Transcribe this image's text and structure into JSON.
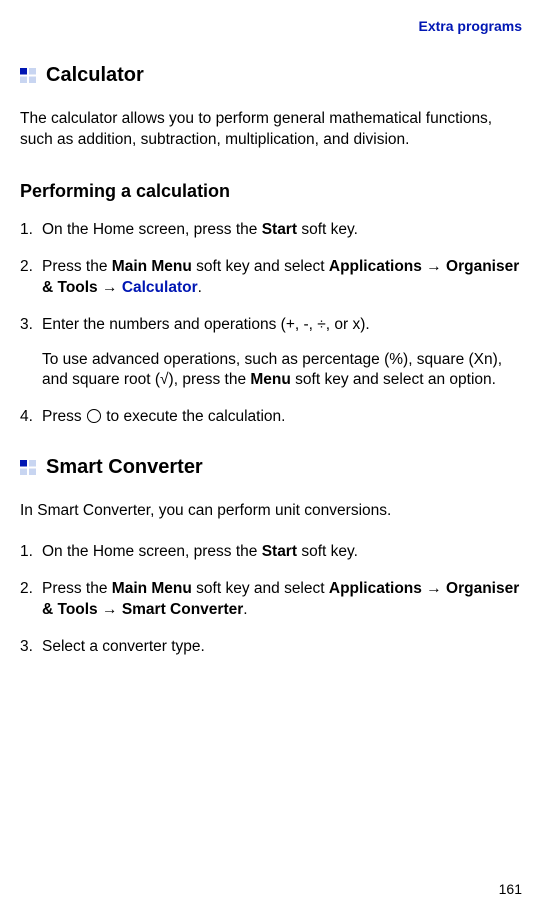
{
  "header": {
    "label": "Extra programs"
  },
  "section1": {
    "title": "Calculator",
    "intro": "The calculator allows you to perform general mathematical functions, such as addition, subtraction, multiplication, and division.",
    "subhead": "Performing a calculation",
    "steps": [
      {
        "num": "1.",
        "parts": {
          "t1": "On the Home screen, press the ",
          "b1": "Start",
          "t2": " soft key."
        }
      },
      {
        "num": "2.",
        "parts": {
          "t1": "Press the ",
          "b1": "Main Menu",
          "t2": " soft key and select ",
          "b2": "Applications",
          "arrow1": " → ",
          "b3": "Organiser & Tools",
          "arrow2": " → ",
          "link": "Calculator",
          "t3": "."
        }
      },
      {
        "num": "3.",
        "parts": {
          "t1": "Enter the numbers and operations (+, -, ÷, or x).",
          "sub_t1": "To use advanced operations, such as percentage (%), square (Xn), and square root (√), press the ",
          "sub_b1": "Menu",
          "sub_t2": " soft key and select an option."
        }
      },
      {
        "num": "4.",
        "parts": {
          "t1": " Press ",
          "t2": " to execute the calculation."
        }
      }
    ]
  },
  "section2": {
    "title": "Smart Converter",
    "intro": "In Smart Converter, you can perform unit conversions.",
    "steps": [
      {
        "num": "1.",
        "parts": {
          "t1": "On the Home screen, press the ",
          "b1": "Start",
          "t2": " soft key."
        }
      },
      {
        "num": "2.",
        "parts": {
          "t1": "Press the ",
          "b1": "Main Menu",
          "t2": " soft key and select ",
          "b2": "Applications",
          "arrow1": " → ",
          "b3": "Organiser & Tools",
          "arrow2": " → ",
          "b4": "Smart Converter",
          "t3": "."
        }
      },
      {
        "num": "3.",
        "parts": {
          "t1": "Select a converter type."
        }
      }
    ]
  },
  "page_number": "161"
}
